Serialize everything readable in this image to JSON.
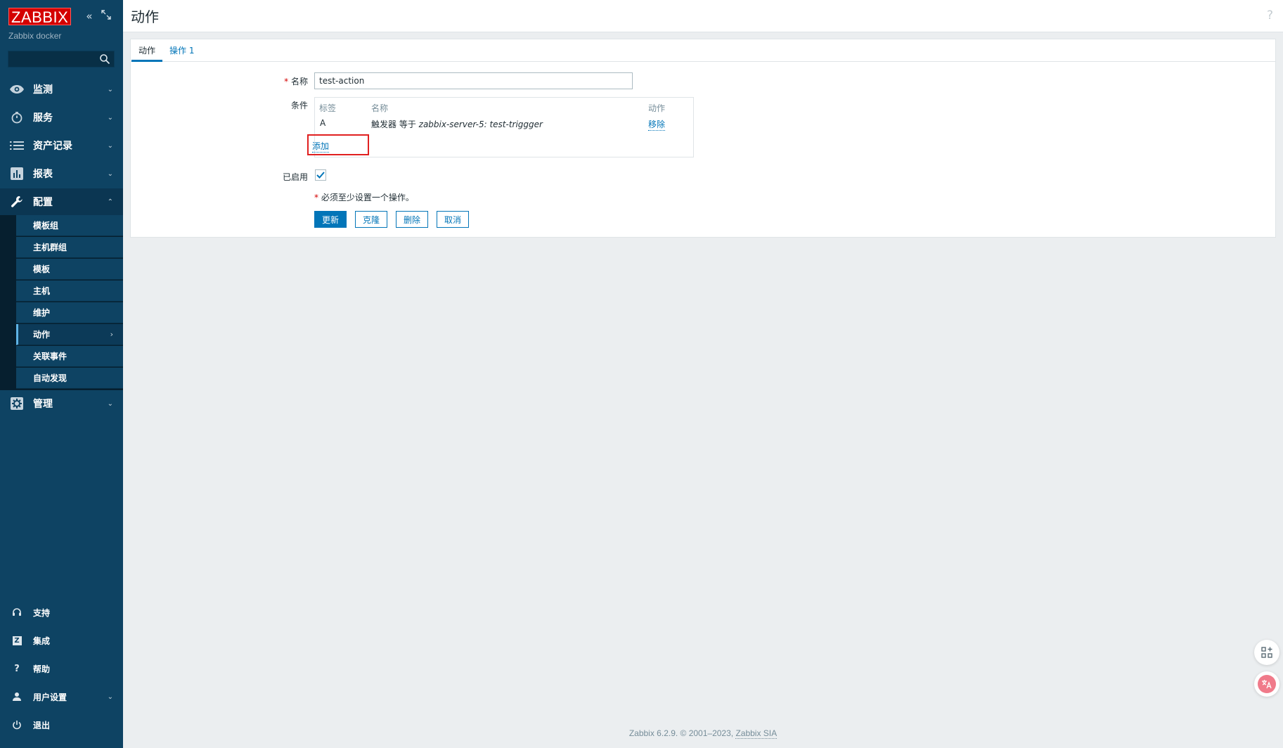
{
  "sidebar": {
    "logo": "ZABBIX",
    "server_name": "Zabbix docker",
    "search_value": "",
    "menu": [
      {
        "label": "监测",
        "icon": "eye-icon",
        "chevron": "⌄"
      },
      {
        "label": "服务",
        "icon": "stopwatch-icon",
        "chevron": "⌄"
      },
      {
        "label": "资产记录",
        "icon": "list-icon",
        "chevron": "⌄"
      },
      {
        "label": "报表",
        "icon": "bar-chart-icon",
        "chevron": "⌄"
      },
      {
        "label": "配置",
        "icon": "wrench-icon",
        "chevron": "⌃"
      },
      {
        "label": "管理",
        "icon": "gear-icon",
        "chevron": "⌄"
      }
    ],
    "submenu": [
      {
        "label": "模板组"
      },
      {
        "label": "主机群组"
      },
      {
        "label": "模板"
      },
      {
        "label": "主机"
      },
      {
        "label": "维护"
      },
      {
        "label": "动作",
        "arrow": "›"
      },
      {
        "label": "关联事件"
      },
      {
        "label": "自动发现"
      }
    ],
    "bottom": [
      {
        "label": "支持",
        "icon": "headset-icon",
        "glyph": "ⓗ"
      },
      {
        "label": "集成",
        "icon": "integrations-icon",
        "glyph": "Z"
      },
      {
        "label": "帮助",
        "icon": "help-icon",
        "glyph": "?"
      },
      {
        "label": "用户设置",
        "icon": "user-icon",
        "glyph": "",
        "chevron": "⌄"
      },
      {
        "label": "退出",
        "icon": "power-icon",
        "glyph": "⏻"
      }
    ]
  },
  "header": {
    "title": "动作",
    "help": "?"
  },
  "tabs": [
    {
      "label": "动作"
    },
    {
      "label": "操作 1"
    }
  ],
  "form": {
    "required_mark": "*",
    "name_label": "名称",
    "name_value": "test-action",
    "conditions_label": "条件",
    "conditions_headers": {
      "tag": "标签",
      "name": "名称",
      "action": "动作"
    },
    "conditions": [
      {
        "tag": "A",
        "name_prefix": "触发器 等于 ",
        "name_value": "zabbix-server-5: test-triggger",
        "action": "移除"
      }
    ],
    "add_label": "添加",
    "enabled_label": "已启用",
    "enabled": true,
    "note": "必须至少设置一个操作。",
    "buttons": {
      "update": "更新",
      "clone": "克隆",
      "delete": "删除",
      "cancel": "取消"
    }
  },
  "footer": {
    "text": "Zabbix 6.2.9. © 2001–2023, ",
    "link": "Zabbix SIA"
  },
  "colors": {
    "sidebar_bg": "#0e4363",
    "accent": "#0275b8",
    "logo_red": "#d40000",
    "highlight": "#e02020"
  }
}
